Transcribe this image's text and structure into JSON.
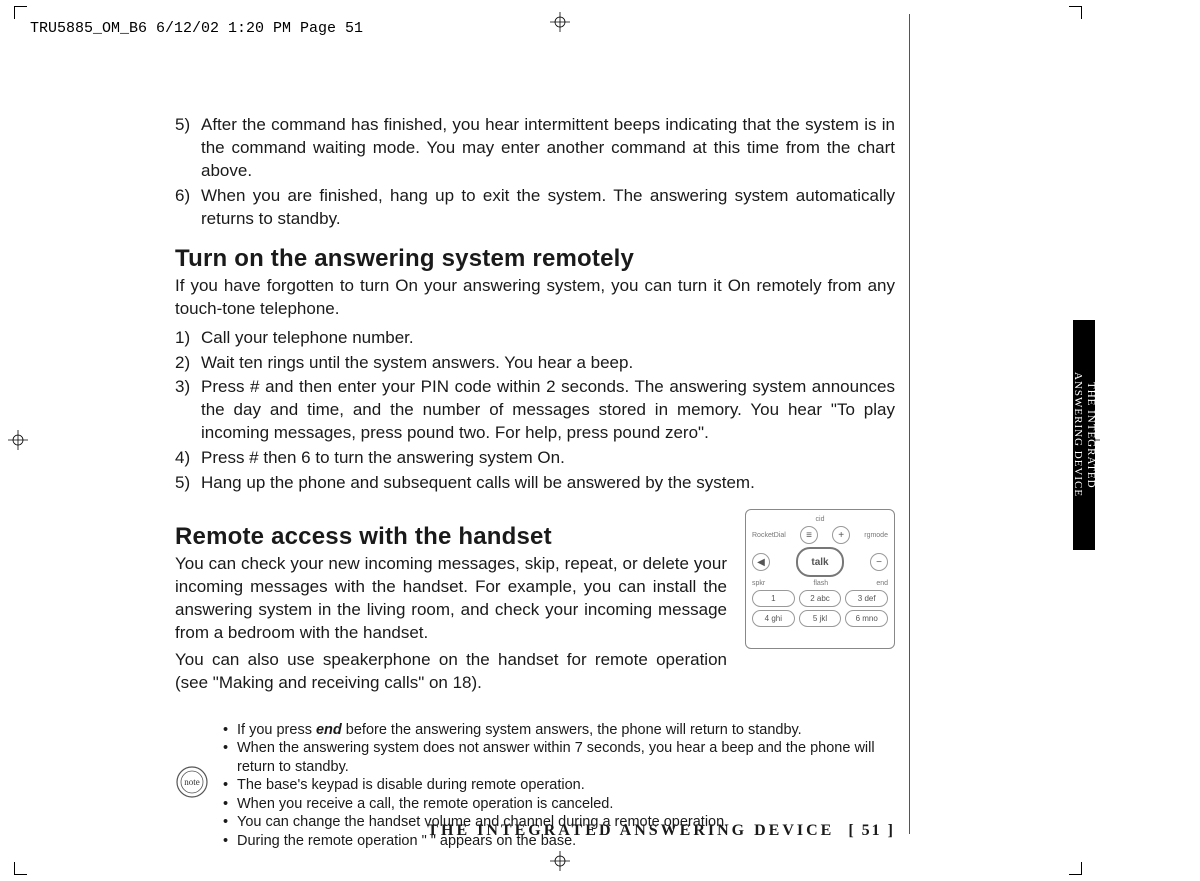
{
  "slug": "TRU5885_OM_B6  6/12/02  1:20 PM  Page 51",
  "sidetab_line1": "THE INTEGRATED",
  "sidetab_line2": "ANSWERING DEVICE",
  "list1": {
    "i5_num": "5)",
    "i5_txt": "After the command has finished, you hear intermittent beeps indicating that the system is in the command waiting mode. You may enter another command at this time from the chart above.",
    "i6_num": "6)",
    "i6_txt": "When you are finished, hang up to exit the system. The answering system automatically returns to standby."
  },
  "h1": "Turn on the answering system remotely",
  "p1": "If you have forgotten to turn On your answering system, you can turn it On remotely from any touch-tone telephone.",
  "list2": {
    "i1_num": "1)",
    "i1_txt": "Call your telephone number.",
    "i2_num": "2)",
    "i2_txt": "Wait ten rings until the system answers. You hear a beep.",
    "i3_num": "3)",
    "i3_txt": "Press # and then enter your PIN code within 2 seconds. The answering system announces the day and time, and the number of messages stored in memory. You hear \"To play incoming messages, press pound two. For help, press pound zero\".",
    "i4_num": "4)",
    "i4_txt": "Press # then 6 to turn the answering system On.",
    "i5_num": "5)",
    "i5_txt": "Hang up the phone and subsequent calls will be answered by the system."
  },
  "h2": "Remote access with the handset",
  "p2a": "You can check your new incoming messages, skip, repeat, or delete your incoming messages with the handset. For example, you can install the answering system in the living room, and check your incoming message from a bedroom with the handset.",
  "p2b": "You can also use speakerphone on the handset for remote operation (see \"Making and receiving calls\" on 18).",
  "keypad": {
    "cid": "cid",
    "rocket": "RocketDial",
    "rgmode": "rgmode",
    "talk": "talk",
    "spkr": "spkr",
    "flash": "flash",
    "end": "end",
    "k1": "1",
    "k2": "2 abc",
    "k3": "3 def",
    "k4": "4 ghi",
    "k5": "5 jkl",
    "k6": "6 mno",
    "plus": "+",
    "minus": "−",
    "menu": "≡"
  },
  "notes": {
    "n1a": "If you press ",
    "n1b": "end",
    "n1c": " before the answering system answers, the phone will return to standby.",
    "n2": "When the answering system does not answer within 7 seconds, you hear a beep and the phone will return to standby.",
    "n3": "The base's keypad is disable during remote operation.",
    "n4": "When you receive a call, the remote operation is canceled.",
    "n5": "You can change the handset volume and channel during a remote operation.",
    "n6": "During the remote operation \"      \" appears on the base."
  },
  "note_label": "note",
  "footer_title": "THE INTEGRATED ANSWERING DEVICE",
  "footer_page": "[ 51 ]"
}
